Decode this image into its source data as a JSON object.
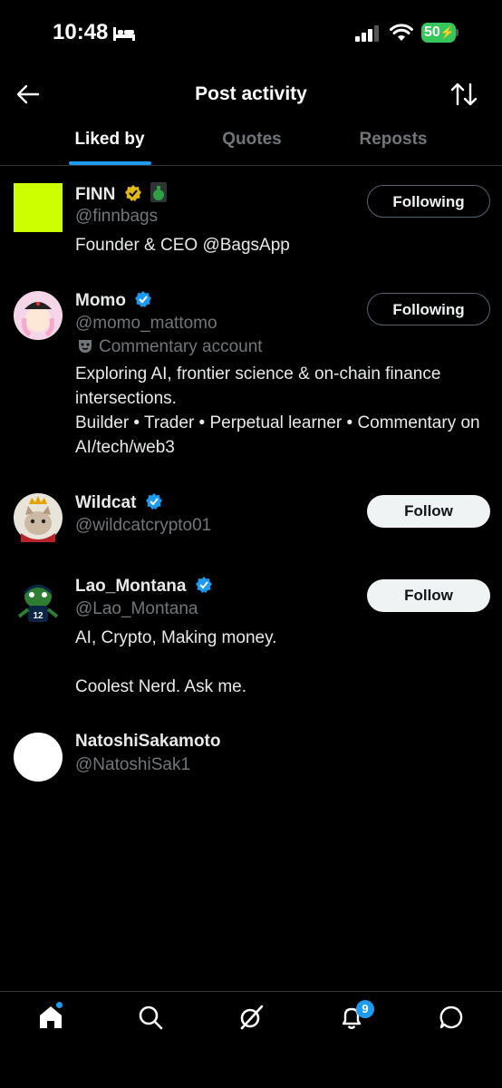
{
  "status_bar": {
    "time": "10:48",
    "battery": "50"
  },
  "header": {
    "title": "Post activity"
  },
  "tabs": [
    {
      "label": "Liked by",
      "active": true
    },
    {
      "label": "Quotes",
      "active": false
    },
    {
      "label": "Reposts",
      "active": false
    }
  ],
  "users": [
    {
      "name": "FINN",
      "handle": "@finnbags",
      "bio": "Founder & CEO @BagsApp",
      "button": "Following",
      "badge": "gold-verified-icon"
    },
    {
      "name": "Momo",
      "handle": "@momo_mattomo",
      "label": "Commentary account",
      "bio": "Exploring AI, frontier science & on-chain finance intersections.\nBuilder • Trader • Perpetual learner • Commentary on AI/tech/web3",
      "button": "Following",
      "badge": "blue-verified-icon"
    },
    {
      "name": "Wildcat",
      "handle": "@wildcatcrypto01",
      "button": "Follow",
      "badge": "blue-verified-icon"
    },
    {
      "name": "Lao_Montana",
      "handle": "@Lao_Montana",
      "bio": "AI, Crypto, Making money.\n\nCoolest Nerd. Ask me.",
      "button": "Follow",
      "badge": "blue-verified-icon"
    },
    {
      "name": "NatoshiSakamoto",
      "handle": "@NatoshiSak1"
    }
  ],
  "bottom_nav": {
    "notifications_badge": "9"
  },
  "colors": {
    "accent": "#1d9bf0",
    "background": "#000000",
    "muted": "#71767b",
    "finn_avatar": "#cdff00"
  }
}
